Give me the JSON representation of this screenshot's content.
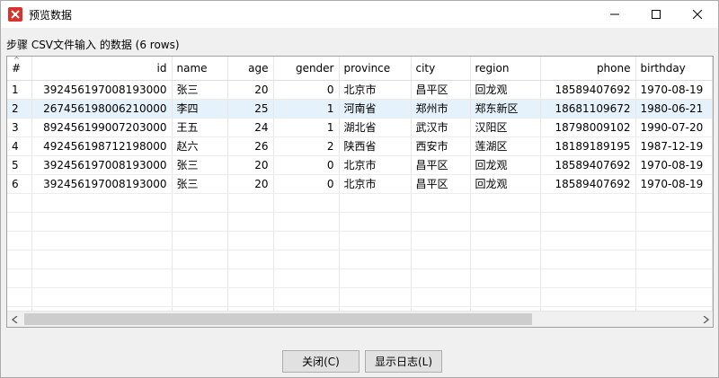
{
  "window": {
    "title": "预览数据",
    "controls": {
      "minimize": "—",
      "maximize": "☐",
      "close": "✕"
    }
  },
  "subtitle": "步骤 CSV文件输入 的数据  (6 rows)",
  "grid": {
    "columns": [
      {
        "key": "rownum",
        "label": "#",
        "align": "left"
      },
      {
        "key": "id",
        "label": "id",
        "align": "right"
      },
      {
        "key": "name",
        "label": "name",
        "align": "left"
      },
      {
        "key": "age",
        "label": "age",
        "align": "right"
      },
      {
        "key": "gender",
        "label": "gender",
        "align": "right"
      },
      {
        "key": "province",
        "label": "province",
        "align": "left"
      },
      {
        "key": "city",
        "label": "city",
        "align": "left"
      },
      {
        "key": "region",
        "label": "region",
        "align": "left"
      },
      {
        "key": "phone",
        "label": "phone",
        "align": "right"
      },
      {
        "key": "birthday",
        "label": "birthday",
        "align": "left"
      }
    ],
    "rows": [
      [
        "1",
        "392456197008193000",
        "张三",
        "20",
        "0",
        "北京市",
        "昌平区",
        "回龙观",
        "18589407692",
        "1970-08-19"
      ],
      [
        "2",
        "267456198006210000",
        "李四",
        "25",
        "1",
        "河南省",
        "郑州市",
        "郑东新区",
        "18681109672",
        "1980-06-21"
      ],
      [
        "3",
        "892456199007203000",
        "王五",
        "24",
        "1",
        "湖北省",
        "武汉市",
        "汉阳区",
        "18798009102",
        "1990-07-20"
      ],
      [
        "4",
        "492456198712198000",
        "赵六",
        "26",
        "2",
        "陕西省",
        "西安市",
        "莲湖区",
        "18189189195",
        "1987-12-19"
      ],
      [
        "5",
        "392456197008193000",
        "张三",
        "20",
        "0",
        "北京市",
        "昌平区",
        "回龙观",
        "18589407692",
        "1970-08-19"
      ],
      [
        "6",
        "392456197008193000",
        "张三",
        "20",
        "0",
        "北京市",
        "昌平区",
        "回龙观",
        "18589407692",
        "1970-08-19"
      ]
    ],
    "selected_row": 2,
    "sort_indicator": "^"
  },
  "scrollbar": {
    "left_arrow": "◀",
    "right_arrow": "▶"
  },
  "buttons": {
    "close": "关闭(C)",
    "show_log": "显示日志(L)"
  },
  "colors": {
    "selection": "#e5f1fb",
    "app_icon": "#d9312b",
    "scroll_thumb": "#cdcdcd"
  }
}
